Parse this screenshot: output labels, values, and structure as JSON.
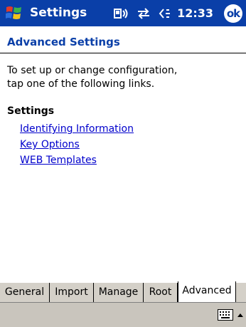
{
  "titlebar": {
    "title": "Settings",
    "clock": "12:33",
    "ok_label": "ok",
    "icons": [
      "windows-start-icon",
      "connectivity-icon",
      "sync-icon",
      "volume-icon"
    ]
  },
  "page": {
    "heading": "Advanced Settings",
    "intro_line1": "To set up or change configuration,",
    "intro_line2": "tap one of the following links.",
    "section_title": "Settings",
    "links": [
      "Identifying Information",
      "Key Options",
      "WEB Templates"
    ]
  },
  "tabs": [
    "General",
    "Import",
    "Manage",
    "Root",
    "Advanced"
  ],
  "active_tab": "Advanced",
  "colors": {
    "titlebar_bg": "#0a3fa8",
    "heading": "#0a3fa8",
    "link": "#0000cc",
    "tab_bg": "#d4d0c8"
  }
}
